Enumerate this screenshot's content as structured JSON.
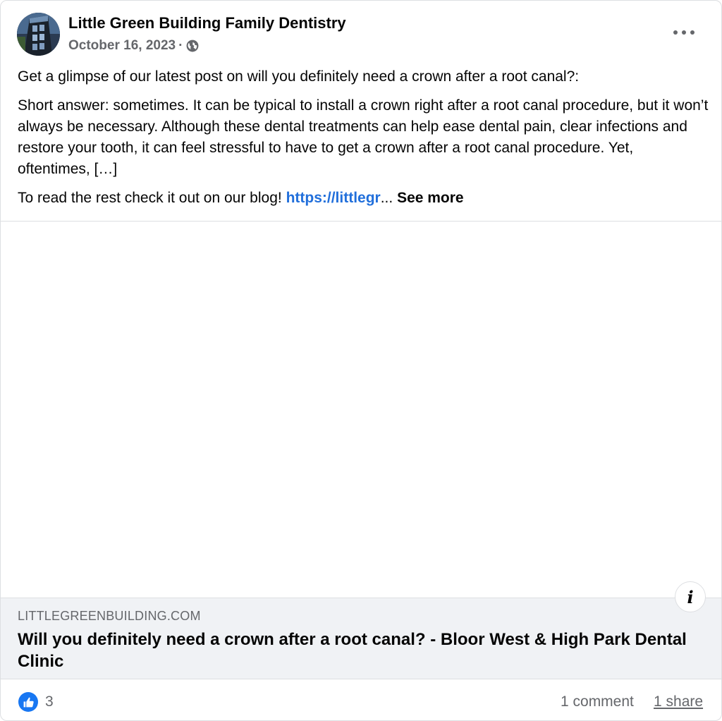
{
  "post": {
    "author": "Little Green Building Family Dentistry",
    "date": "October 16, 2023",
    "separator": "·",
    "privacy_icon": "globe-icon",
    "more_icon": "more-options-icon",
    "paragraph_1": "Get a glimpse of our latest post on will you definitely need a crown after a root canal?:",
    "paragraph_2": "Short answer: sometimes. It can be typical to install a crown right after a root canal procedure, but it won’t always be necessary. Although these dental treatments can help ease dental pain, clear infections and restore your tooth, it can feel stressful to have to get a crown after a root canal procedure. Yet, oftentimes, […]",
    "paragraph_3_prefix": "To read the rest check it out on our blog! ",
    "link_text": "https://littlegr",
    "ellipsis": "... ",
    "see_more": "See more"
  },
  "preview": {
    "domain": "LITTLEGREENBUILDING.COM",
    "title": "Will you definitely need a crown after a root canal? - Bloor West & High Park Dental Clinic",
    "info_icon": "info-icon",
    "info_label": "i"
  },
  "footer": {
    "reaction_icon": "like-icon",
    "reaction_count": "3",
    "comments": "1 comment",
    "shares": "1 share"
  },
  "colors": {
    "link": "#216fdb",
    "like_blue": "#1877f2",
    "secondary_text": "#65676b",
    "preview_bg": "#f0f2f5"
  }
}
